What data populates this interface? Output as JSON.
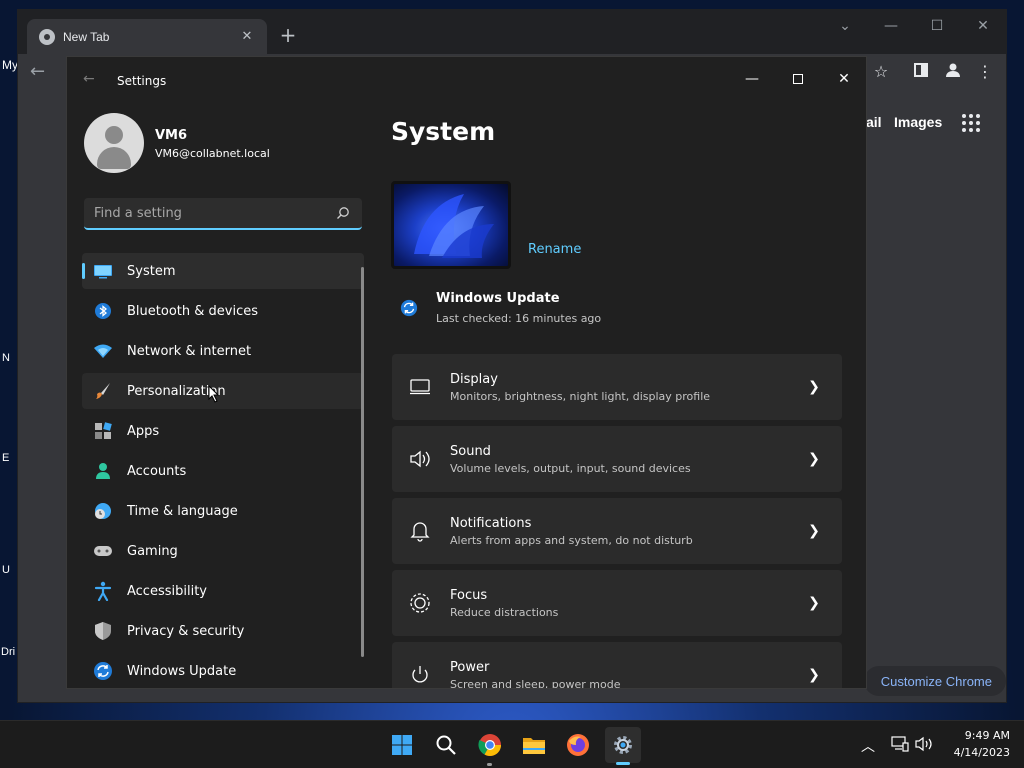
{
  "chrome": {
    "tab_title": "New Tab",
    "new_tab_glyph": "+",
    "nav_links": [
      "ail",
      "Images"
    ],
    "customize_label": "Customize Chrome",
    "edge_text": "My"
  },
  "desktop": {
    "icon_labels": [
      "N",
      "E",
      "U",
      "Dri"
    ]
  },
  "settings": {
    "window_title": "Settings",
    "user": {
      "name": "VM6",
      "email": "VM6@collabnet.local"
    },
    "search": {
      "placeholder": "Find a setting"
    },
    "nav": [
      {
        "label": "System",
        "icon": "system-icon",
        "selected": true
      },
      {
        "label": "Bluetooth & devices",
        "icon": "bluetooth-icon"
      },
      {
        "label": "Network & internet",
        "icon": "network-icon"
      },
      {
        "label": "Personalization",
        "icon": "personalization-icon",
        "hover": true
      },
      {
        "label": "Apps",
        "icon": "apps-icon"
      },
      {
        "label": "Accounts",
        "icon": "accounts-icon"
      },
      {
        "label": "Time & language",
        "icon": "time-language-icon"
      },
      {
        "label": "Gaming",
        "icon": "gaming-icon"
      },
      {
        "label": "Accessibility",
        "icon": "accessibility-icon"
      },
      {
        "label": "Privacy & security",
        "icon": "privacy-shield-icon"
      },
      {
        "label": "Windows Update",
        "icon": "windows-update-icon"
      }
    ],
    "page_title": "System",
    "rename_label": "Rename",
    "windows_update": {
      "title": "Windows Update",
      "status": "Last checked: 16 minutes ago"
    },
    "cards": [
      {
        "title": "Display",
        "desc": "Monitors, brightness, night light, display profile",
        "icon": "display-icon"
      },
      {
        "title": "Sound",
        "desc": "Volume levels, output, input, sound devices",
        "icon": "sound-icon"
      },
      {
        "title": "Notifications",
        "desc": "Alerts from apps and system, do not disturb",
        "icon": "bell-icon"
      },
      {
        "title": "Focus",
        "desc": "Reduce distractions",
        "icon": "focus-icon"
      },
      {
        "title": "Power",
        "desc": "Screen and sleep, power mode",
        "icon": "power-icon"
      }
    ]
  },
  "taskbar": {
    "apps": [
      "windows-start-icon",
      "search-icon",
      "chrome-icon",
      "file-explorer-icon",
      "firefox-icon",
      "settings-gear-icon"
    ],
    "time": "9:49 AM",
    "date": "4/14/2023"
  },
  "colors": {
    "accent": "#60cdff",
    "window_bg": "#202020",
    "card_bg": "#2b2b2b"
  }
}
